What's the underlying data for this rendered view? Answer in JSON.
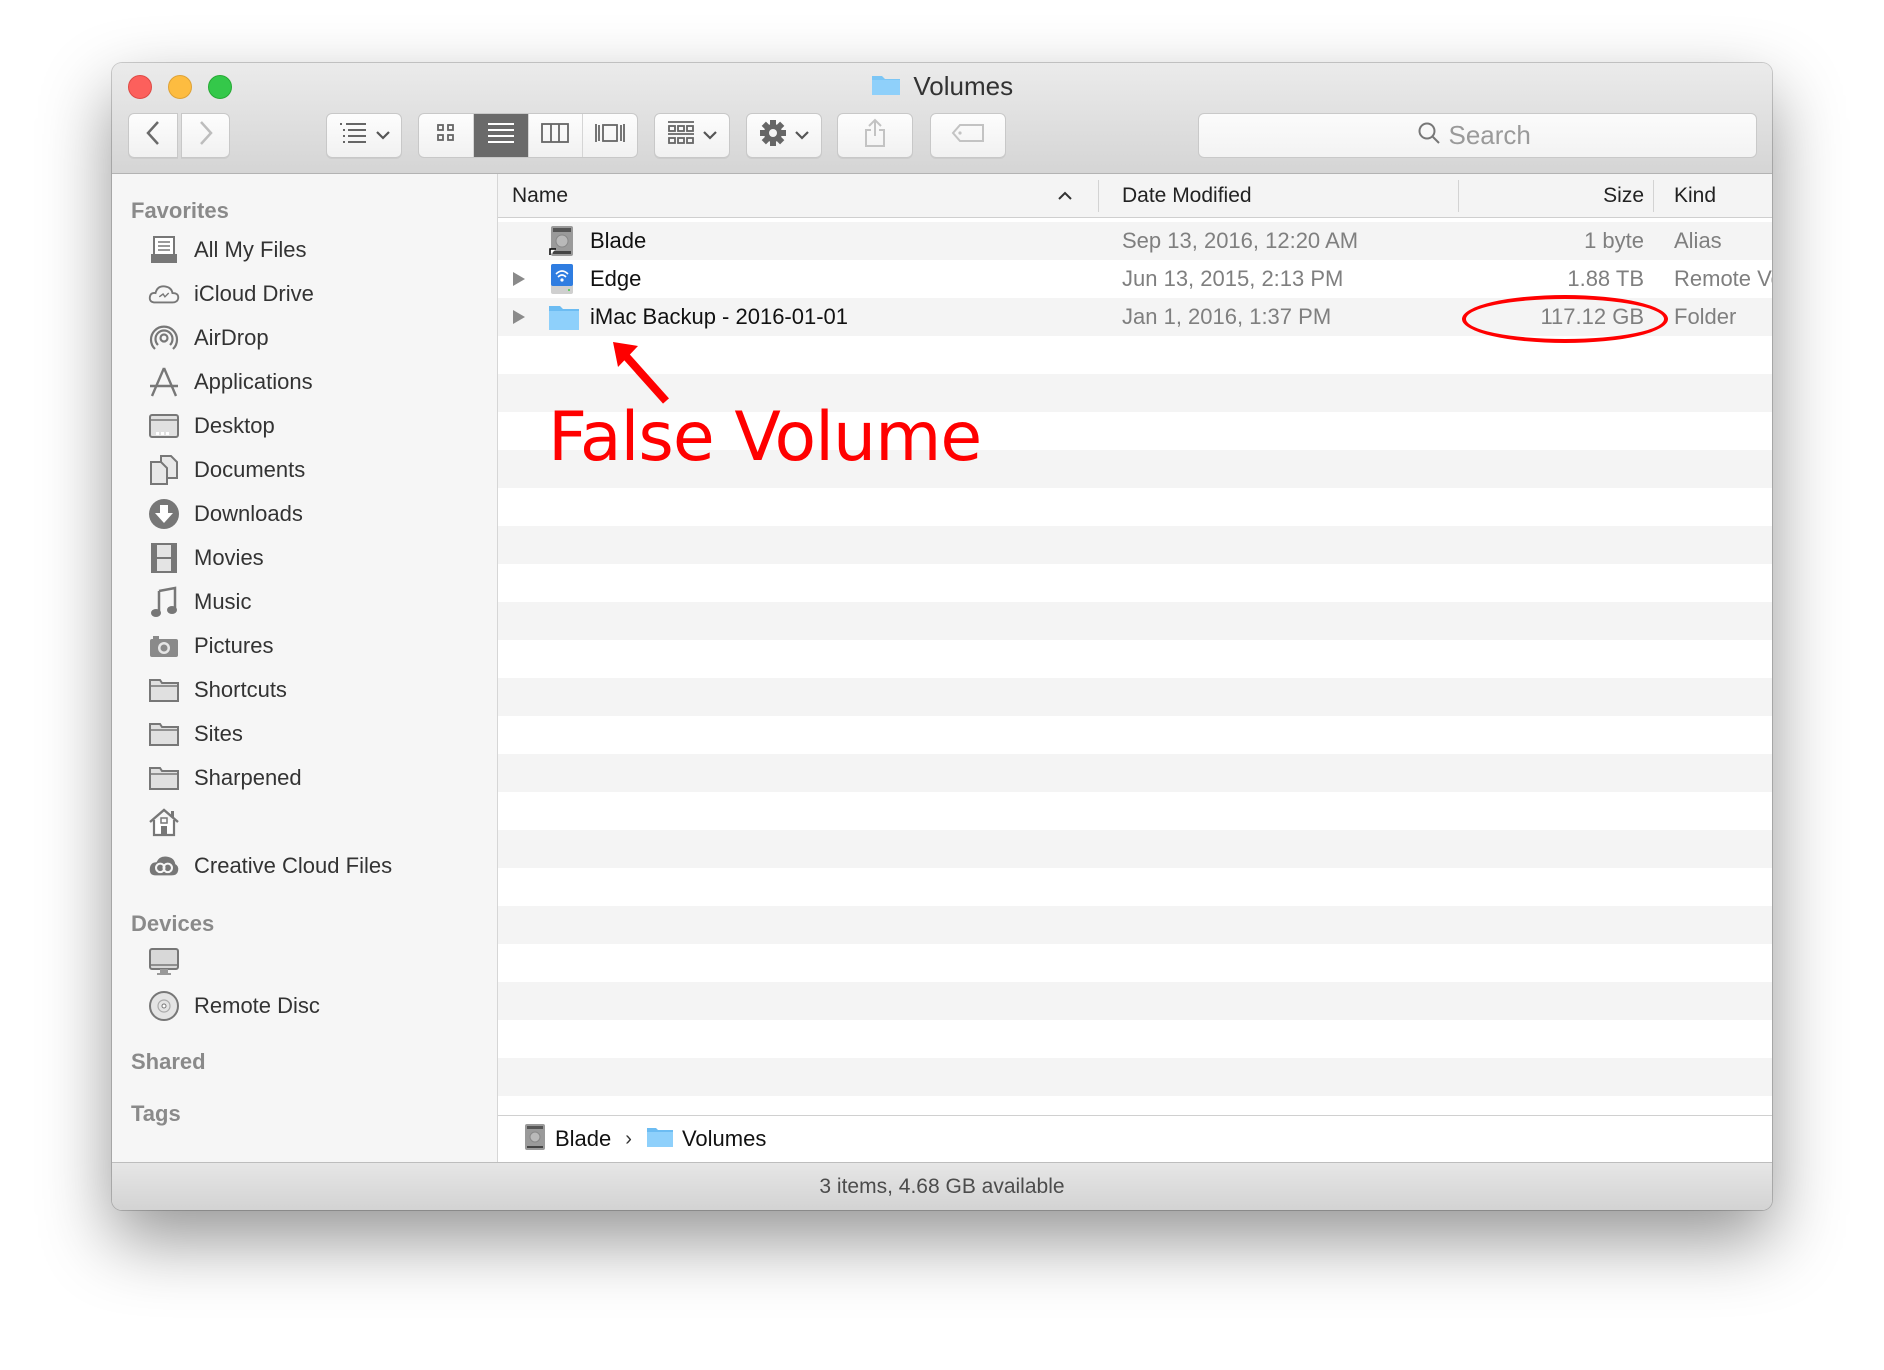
{
  "window": {
    "title": "Volumes",
    "title_icon": "folder-icon"
  },
  "toolbar": {
    "back": "chevron-left-icon",
    "forward": "chevron-right-icon",
    "arrange": "list-arrange-icon",
    "views": [
      {
        "name": "icon-view",
        "icon": "grid-icon",
        "active": false
      },
      {
        "name": "list-view",
        "icon": "list-icon",
        "active": true
      },
      {
        "name": "column-view",
        "icon": "columns-icon",
        "active": false
      },
      {
        "name": "cover-flow-view",
        "icon": "coverflow-icon",
        "active": false
      }
    ],
    "group": "group-by-icon",
    "action": "gear-icon",
    "share": "share-icon",
    "tags": "tag-icon",
    "search_placeholder": "Search"
  },
  "sidebar": {
    "favorites_header": "Favorites",
    "favorites": [
      {
        "label": "All My Files",
        "icon": "all-my-files-icon"
      },
      {
        "label": "iCloud Drive",
        "icon": "icloud-icon"
      },
      {
        "label": "AirDrop",
        "icon": "airdrop-icon"
      },
      {
        "label": "Applications",
        "icon": "applications-icon"
      },
      {
        "label": "Desktop",
        "icon": "desktop-icon"
      },
      {
        "label": "Documents",
        "icon": "documents-icon"
      },
      {
        "label": "Downloads",
        "icon": "downloads-icon"
      },
      {
        "label": "Movies",
        "icon": "movies-icon"
      },
      {
        "label": "Music",
        "icon": "music-icon"
      },
      {
        "label": "Pictures",
        "icon": "camera-icon"
      },
      {
        "label": "Shortcuts",
        "icon": "folder-icon"
      },
      {
        "label": "Sites",
        "icon": "folder-icon"
      },
      {
        "label": "Sharpened",
        "icon": "folder-icon"
      },
      {
        "label": "",
        "icon": "home-icon"
      },
      {
        "label": "Creative Cloud Files",
        "icon": "creative-cloud-icon"
      }
    ],
    "devices_header": "Devices",
    "devices": [
      {
        "label": "",
        "icon": "imac-icon"
      },
      {
        "label": "Remote Disc",
        "icon": "disc-icon"
      }
    ],
    "shared_header": "Shared",
    "tags_header": "Tags"
  },
  "columns": {
    "name": "Name",
    "date": "Date Modified",
    "size": "Size",
    "kind": "Kind",
    "sort_indicator": "^"
  },
  "files": [
    {
      "name": "Blade",
      "date": "Sep 13, 2016, 12:20 AM",
      "size": "1 byte",
      "kind": "Alias",
      "icon": "hard-drive-alias-icon",
      "expandable": false
    },
    {
      "name": "Edge",
      "date": "Jun 13, 2015, 2:13 PM",
      "size": "1.88 TB",
      "kind": "Remote Volume",
      "icon": "network-drive-icon",
      "expandable": true
    },
    {
      "name": "iMac Backup - 2016-01-01",
      "date": "Jan 1, 2016, 1:37 PM",
      "size": "117.12 GB",
      "kind": "Folder",
      "icon": "folder-icon",
      "expandable": true
    }
  ],
  "pathbar": {
    "crumbs": [
      {
        "label": "Blade",
        "icon": "hard-drive-icon"
      },
      {
        "label": "Volumes",
        "icon": "folder-icon"
      }
    ],
    "separator": "›"
  },
  "status": {
    "text": "3 items, 4.68 GB available"
  },
  "horizontal_scroll": {
    "visible_fraction": 0.91,
    "position": 0
  },
  "annotation": {
    "label": "False Volume",
    "color": "#ff0000",
    "highlighted_value": "117.12 GB"
  }
}
